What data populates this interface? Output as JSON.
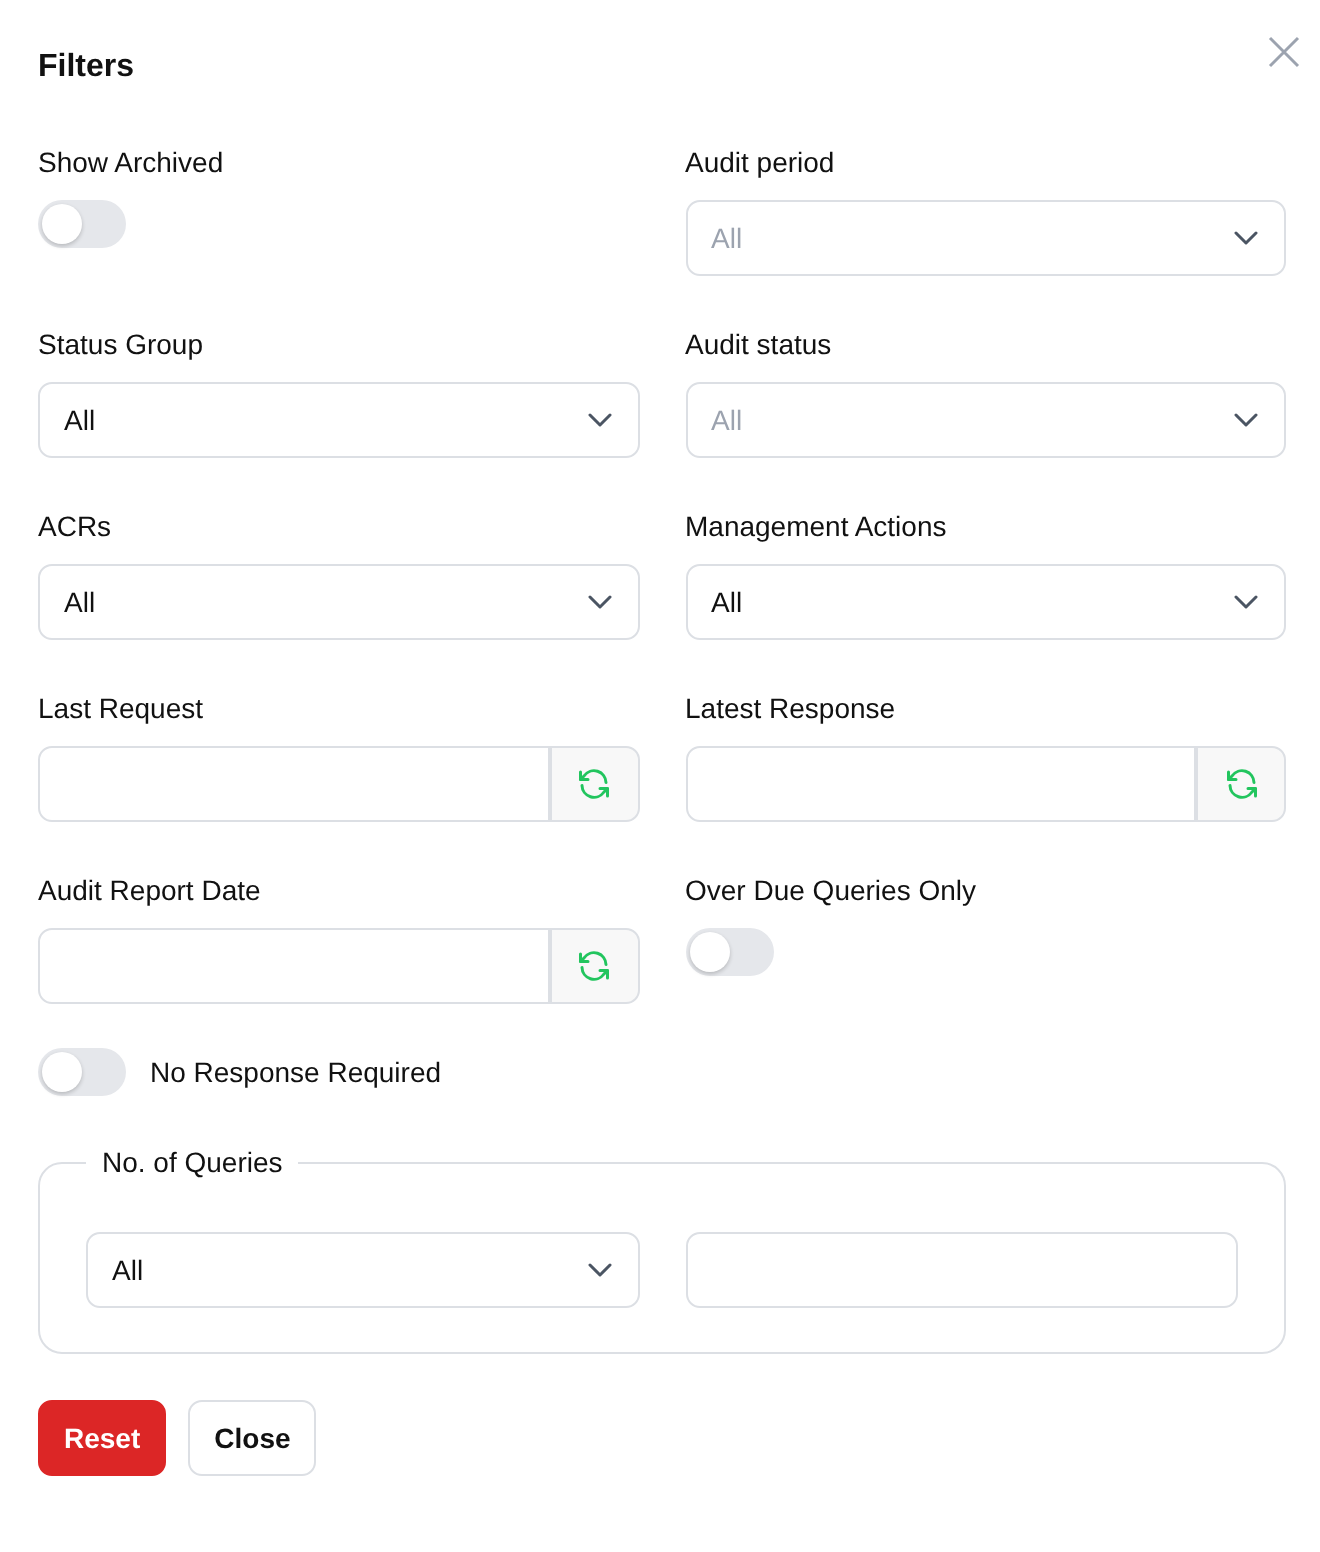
{
  "dialog": {
    "title": "Filters"
  },
  "fields": [
    {
      "kind": "toggle",
      "label": "Show Archived",
      "on": false
    },
    {
      "kind": "select",
      "label": "Audit period",
      "value": "All",
      "disabled": true
    },
    {
      "kind": "select",
      "label": "Status Group",
      "value": "All",
      "disabled": false
    },
    {
      "kind": "select",
      "label": "Audit status",
      "value": "All",
      "disabled": true
    },
    {
      "kind": "select",
      "label": "ACRs",
      "value": "All",
      "disabled": false
    },
    {
      "kind": "select",
      "label": "Management Actions",
      "value": "All",
      "disabled": false
    },
    {
      "kind": "date",
      "label": "Last Request"
    },
    {
      "kind": "date",
      "label": "Latest Response"
    },
    {
      "kind": "date",
      "label": "Audit Report Date"
    },
    {
      "kind": "toggle",
      "label": "Over Due Queries Only",
      "on": false
    }
  ],
  "no_response": {
    "label": "No Response Required",
    "on": false
  },
  "queries": {
    "legend": "No. of Queries",
    "select": {
      "value": "All",
      "disabled": false
    }
  },
  "buttons": [
    {
      "label": "Reset",
      "kind": "primary"
    },
    {
      "label": "Close",
      "kind": "secondary"
    }
  ]
}
